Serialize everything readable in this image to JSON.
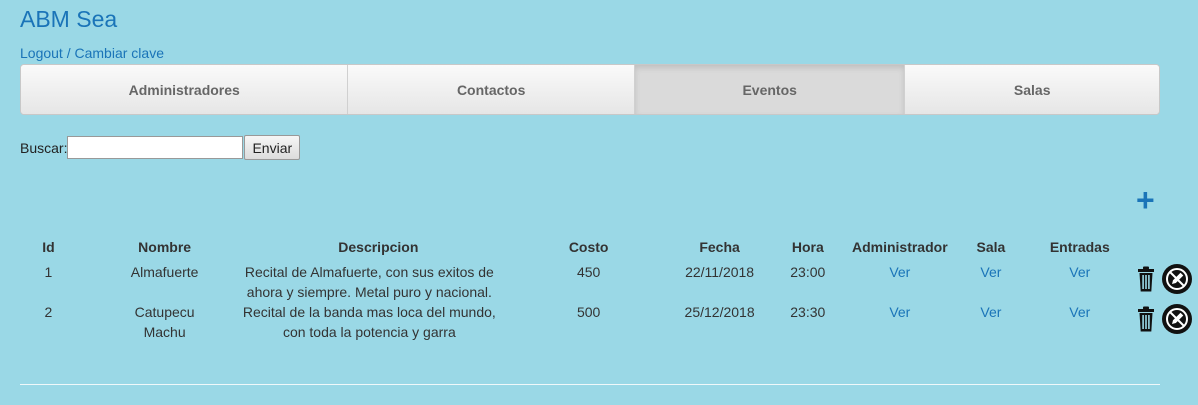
{
  "app": {
    "title": "ABM Sea"
  },
  "auth": {
    "logout": "Logout",
    "separator": " / ",
    "change_password": "Cambiar clave"
  },
  "tabs": [
    {
      "label": "Administradores",
      "active": false
    },
    {
      "label": "Contactos",
      "active": false
    },
    {
      "label": "Eventos",
      "active": true
    },
    {
      "label": "Salas",
      "active": false
    }
  ],
  "search": {
    "label": "Buscar:",
    "value": "",
    "button": "Enviar"
  },
  "add_label": "+",
  "table": {
    "headers": [
      "Id",
      "Nombre",
      "Descripcion",
      "Costo",
      "Fecha",
      "Hora",
      "Administrador",
      "Sala",
      "Entradas"
    ],
    "rows": [
      {
        "id": "1",
        "nombre": "Almafuerte",
        "descripcion": "Recital de Almafuerte, con sus exitos de ahora y siempre. Metal puro y nacional.",
        "costo": "450",
        "fecha": "22/11/2018",
        "hora": "23:00",
        "administrador": "Ver",
        "sala": "Ver",
        "entradas": "Ver"
      },
      {
        "id": "2",
        "nombre": "Catupecu Machu",
        "descripcion": "Recital de la banda mas loca del mundo, con toda la potencia y garra",
        "costo": "500",
        "fecha": "25/12/2018",
        "hora": "23:30",
        "administrador": "Ver",
        "sala": "Ver",
        "entradas": "Ver"
      }
    ]
  },
  "icons": {
    "delete": "trash-icon",
    "edit": "edit-pencil-icon",
    "add": "plus-icon"
  },
  "colors": {
    "background": "#9ad8e6",
    "link": "#1a74b8",
    "tab_active": "#dadada"
  }
}
